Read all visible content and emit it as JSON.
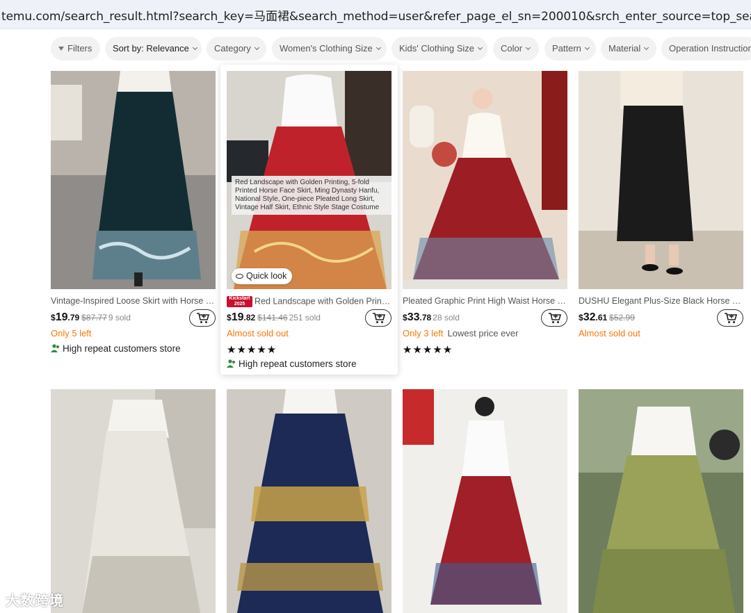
{
  "browser": {
    "url": "temu.com/search_result.html?search_key=马面裙&search_method=user&refer_page_el_sn=200010&srch_enter_source=top_search_entrance"
  },
  "filters": [
    {
      "label": "Filters",
      "icon": "funnel-icon"
    },
    {
      "label": "Sort by: Relevance"
    },
    {
      "label": "Category"
    },
    {
      "label": "Women's Clothing Size"
    },
    {
      "label": "Kids' Clothing Size"
    },
    {
      "label": "Color"
    },
    {
      "label": "Pattern"
    },
    {
      "label": "Material"
    },
    {
      "label": "Operation Instruction"
    }
  ],
  "products": [
    {
      "title": "Vintage-Inspired Loose Skirt with Horse Face Pattern",
      "price_int": "19",
      "price_cents": ".79",
      "currency": "$",
      "old_price": "$87.77",
      "sold": "9 sold",
      "stock": "Only 5 left",
      "store": "High repeat customers store"
    },
    {
      "title": "Red Landscape with Golden Printing, 5-fold Printed Horse Face Skirt",
      "badge_line1": "Kickstart",
      "badge_line2": "2025",
      "price_int": "19",
      "price_cents": ".82",
      "currency": "$",
      "old_price": "$141.46",
      "sold": "251 sold",
      "stock": "Almost sold out",
      "rating": "★★★★★",
      "store": "High repeat customers store",
      "tooltip": "Red Landscape with Golden Printing, 5-fold Printed Horse Face Skirt, Ming Dynasty Hanfu, National Style, One-piece Pleated Long Skirt, Vintage Half Skirt, Ethnic Style Stage Costume",
      "quick_look": "Quick look"
    },
    {
      "title": "Pleated Graphic Print High Waist Horse Face Skirt",
      "price_int": "33",
      "price_cents": ".78",
      "currency": "$",
      "sold": "28 sold",
      "stock": "Only 3 left",
      "stock_extra": "Lowest price ever",
      "rating": "★★★★★"
    },
    {
      "title": "DUSHU Elegant Plus-Size Black Horse Face Skirt",
      "price_int": "32",
      "price_cents": ".61",
      "currency": "$",
      "old_price": "$52.99",
      "stock": "Almost sold out"
    }
  ],
  "watermark": "大数跨境",
  "colors": {
    "accent": "#fb7701",
    "chip_bg": "#f2f2f2"
  }
}
